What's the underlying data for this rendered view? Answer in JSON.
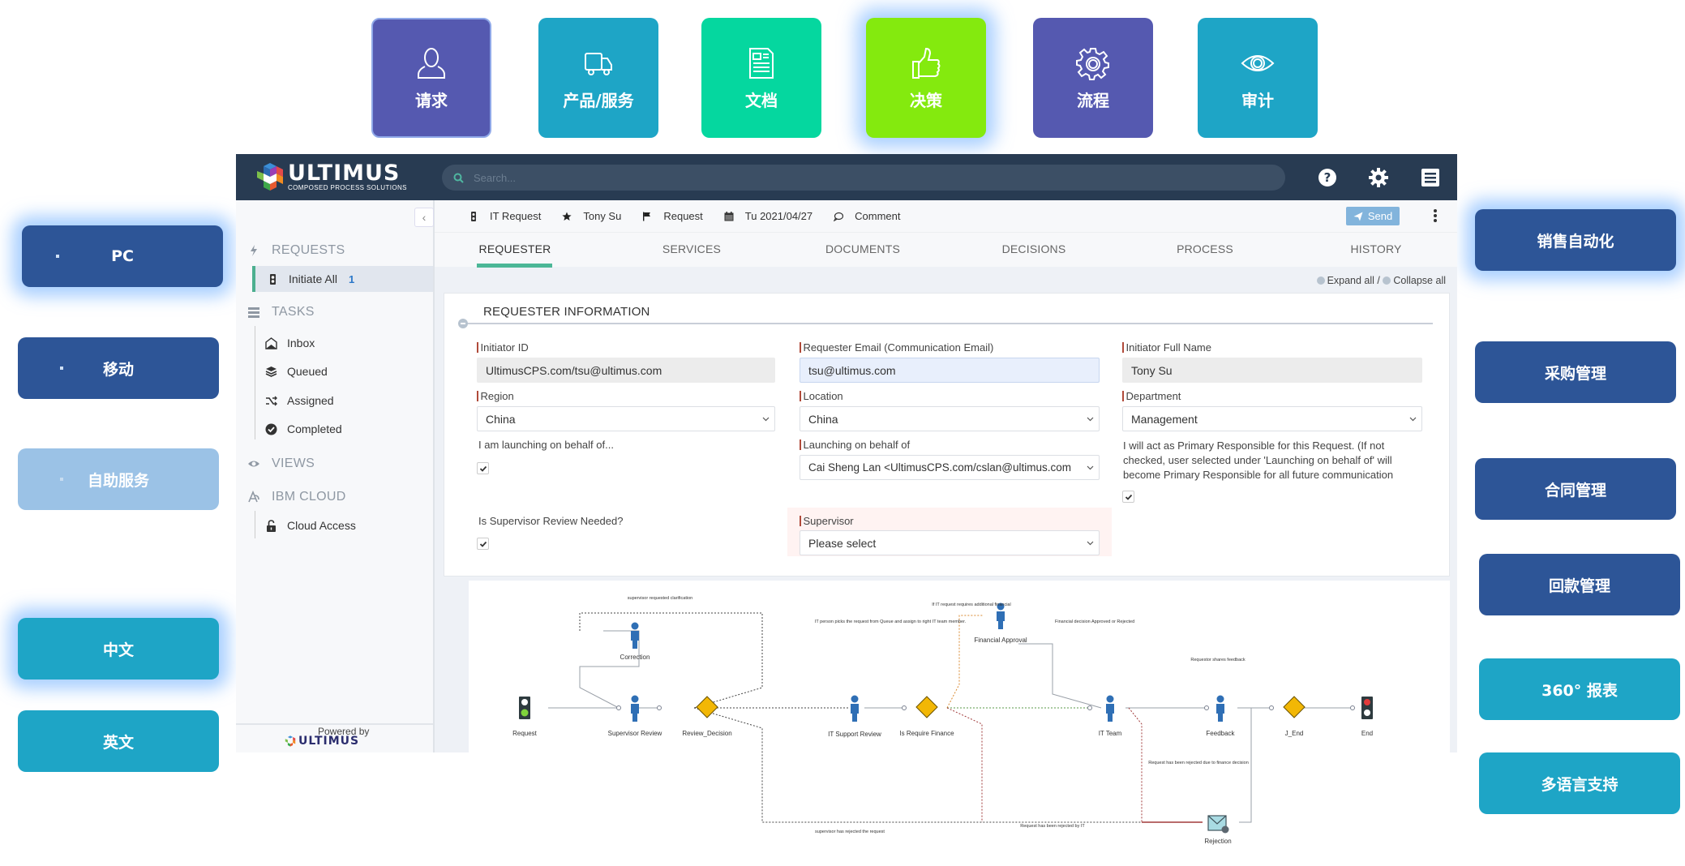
{
  "top_tiles": [
    {
      "label": "请求",
      "icon": "person-icon",
      "color": "#5559b0"
    },
    {
      "label": "产品/服务",
      "icon": "truck-icon",
      "color": "#1ea5c6"
    },
    {
      "label": "文档",
      "icon": "document-icon",
      "color": "#05d79f"
    },
    {
      "label": "决策",
      "icon": "thumbs-up-icon",
      "color": "#84ea0e",
      "highlighted": true
    },
    {
      "label": "流程",
      "icon": "gear-icon",
      "color": "#5559b0"
    },
    {
      "label": "审计",
      "icon": "eye-icon",
      "color": "#1ea5c6"
    }
  ],
  "left_pills": [
    {
      "label": "PC",
      "color": "#2d5597",
      "highlighted": true
    },
    {
      "label": "移动",
      "color": "#2d5597"
    },
    {
      "label": "自助服务",
      "color": "#9bc2e6"
    },
    {
      "label": "中文",
      "color": "#1ea5c6",
      "highlighted": true
    },
    {
      "label": "英文",
      "color": "#1ea5c6"
    }
  ],
  "right_pills": [
    {
      "label": "销售自动化",
      "color": "#2d5597",
      "highlighted": true
    },
    {
      "label": "采购管理",
      "color": "#2d5597"
    },
    {
      "label": "合同管理",
      "color": "#2d5597"
    },
    {
      "label": "回款管理",
      "color": "#2d5597"
    },
    {
      "label": "360° 报表",
      "color": "#1ea5c6"
    },
    {
      "label": "多语言支持",
      "color": "#1ea5c6"
    }
  ],
  "app": {
    "logo": {
      "name": "ULTIMUS",
      "tagline": "COMPOSED PROCESS SOLUTIONS"
    },
    "search": {
      "placeholder": "Search..."
    },
    "topbar_icons": [
      "help-icon",
      "settings-icon",
      "menu-icon"
    ],
    "sidebar": {
      "sections": [
        {
          "label": "REQUESTS",
          "icon": "bolt-icon"
        },
        {
          "label": "TASKS",
          "icon": "server-icon"
        },
        {
          "label": "VIEWS",
          "icon": "eye-icon"
        },
        {
          "label": "IBM CLOUD",
          "icon": "cloud-icon"
        }
      ],
      "items": [
        {
          "label": "Initiate All",
          "badge": "1",
          "icon": "traffic-light-icon",
          "active": true
        },
        {
          "label": "Inbox",
          "icon": "envelope-open-icon"
        },
        {
          "label": "Queued",
          "icon": "stack-icon"
        },
        {
          "label": "Assigned",
          "icon": "shuffle-icon"
        },
        {
          "label": "Completed",
          "icon": "check-circle-icon"
        },
        {
          "label": "Cloud Access",
          "icon": "unlock-icon"
        }
      ],
      "powered_by": "Powered by",
      "powered_logo": "ULTIMUS"
    },
    "crumbs": [
      {
        "label": "IT Request",
        "icon": "traffic-light-icon"
      },
      {
        "label": "Tony Su",
        "icon": "star-icon"
      },
      {
        "label": "Request",
        "icon": "flag-icon"
      },
      {
        "label": "Tu 2021/04/27",
        "icon": "calendar-icon"
      },
      {
        "label": "Comment",
        "icon": "comment-icon"
      }
    ],
    "send_label": "Send",
    "tabs": [
      "REQUESTER",
      "SERVICES",
      "DOCUMENTS",
      "DECISIONS",
      "PROCESS",
      "HISTORY"
    ],
    "active_tab": "REQUESTER",
    "expand_all": "Expand all /",
    "collapse_all": "Collapse all",
    "form": {
      "title": "REQUESTER INFORMATION",
      "initiator_id": {
        "label": "Initiator ID",
        "value": "UltimusCPS.com/tsu@ultimus.com"
      },
      "requester_email": {
        "label": "Requester Email (Communication Email)",
        "value": "tsu@ultimus.com"
      },
      "initiator_full_name": {
        "label": "Initiator Full Name",
        "value": "Tony Su"
      },
      "region": {
        "label": "Region",
        "value": "China"
      },
      "location": {
        "label": "Location",
        "value": "China"
      },
      "department": {
        "label": "Department",
        "value": "Management"
      },
      "on_behalf_question": {
        "label": "I am launching on behalf of...",
        "checked": true
      },
      "launching_on_behalf": {
        "label": "Launching on behalf of",
        "value": "Cai Sheng Lan <UltimusCPS.com/cslan@ultimus.com"
      },
      "primary_responsible": {
        "label": "I will act as Primary Responsible for this Request. (If not checked, user selected under 'Launching on behalf of' will become Primary Responsible for all future communication",
        "checked": true
      },
      "supervisor_review": {
        "label": "Is Supervisor Review Needed?",
        "checked": true
      },
      "supervisor": {
        "label": "Supervisor",
        "value": "Please select"
      }
    }
  },
  "process_diagram": {
    "nodes": [
      {
        "id": "request",
        "label": "Request",
        "type": "start"
      },
      {
        "id": "correction",
        "label": "Correction",
        "type": "human"
      },
      {
        "id": "supervisor_review",
        "label": "Supervisor Review",
        "type": "human"
      },
      {
        "id": "review_decision",
        "label": "Review_Decision",
        "type": "gateway"
      },
      {
        "id": "it_support_review",
        "label": "IT Support Review",
        "type": "human"
      },
      {
        "id": "is_require_finance",
        "label": "Is Require Finance",
        "type": "gateway"
      },
      {
        "id": "financial_approval",
        "label": "Financial Approval",
        "type": "human"
      },
      {
        "id": "it_team",
        "label": "IT Team",
        "type": "human"
      },
      {
        "id": "feedback",
        "label": "Feedback",
        "type": "human"
      },
      {
        "id": "j_end",
        "label": "J_End",
        "type": "gateway"
      },
      {
        "id": "end",
        "label": "End",
        "type": "end"
      },
      {
        "id": "rejection",
        "label": "Rejection",
        "type": "email"
      }
    ],
    "annotations": [
      "supervisor requested clarification",
      "If IT request requires additional financial",
      "IT person picks the request from Queue and assign to right IT team member.",
      "Financial decision Approved or Rejected",
      "Requestor shares feedback",
      "Request has been rejected due to finance decision",
      "supervisor has rejected the request",
      "Request has been rejected by IT"
    ]
  }
}
